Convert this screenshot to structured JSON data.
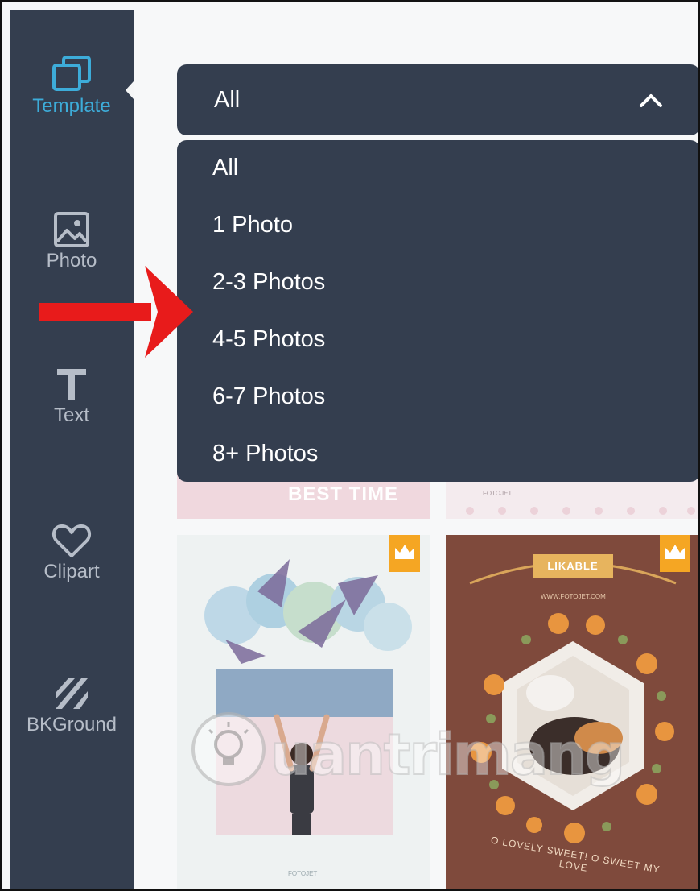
{
  "sidebar": {
    "items": [
      {
        "label": "Template",
        "icon": "template-icon",
        "active": true
      },
      {
        "label": "Photo",
        "icon": "photo-icon",
        "active": false
      },
      {
        "label": "Text",
        "icon": "text-icon",
        "active": false
      },
      {
        "label": "Clipart",
        "icon": "heart-icon",
        "active": false
      },
      {
        "label": "BKGround",
        "icon": "stripes-icon",
        "active": false
      }
    ]
  },
  "dropdown": {
    "selected": "All",
    "icon": "chevron-up-icon",
    "options": [
      "All",
      "1 Photo",
      "2-3 Photos",
      "4-5 Photos",
      "6-7 Photos",
      "8+ Photos"
    ]
  },
  "cards": {
    "top_left_text": "BEST TIME",
    "top_right_text": "FOTOJET",
    "bottom_left_footer": "FOTOJET",
    "bottom_right_ribbon": "LIKABLE",
    "bottom_right_site": "WWW.FOTOJET.COM",
    "bottom_right_tagline": "O LOVELY SWEET! O SWEET MY LOVE",
    "premium_icon": "crown-icon"
  },
  "watermark": {
    "text": "uantrimang",
    "icon": "lightbulb-icon"
  },
  "colors": {
    "sidebar_bg": "#343e4f",
    "active_accent": "#3dacd9",
    "dropdown_bg": "#343e4f",
    "arrow": "#e81b1b",
    "crown_bg": "#f5a623"
  }
}
